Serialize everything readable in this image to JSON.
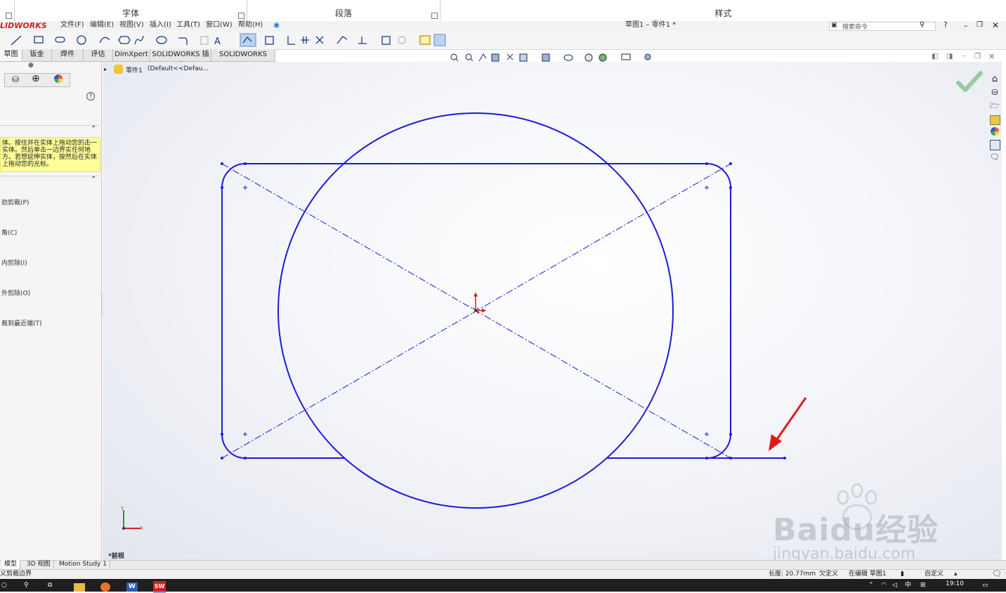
{
  "word_ribbon": {
    "groups": [
      {
        "label": "字体"
      },
      {
        "label": "段落"
      },
      {
        "label": "样式"
      }
    ]
  },
  "menubar": {
    "logo": "LIDWORKS",
    "items": [
      "文件(F)",
      "编辑(E)",
      "视图(V)",
      "插入(I)",
      "工具(T)",
      "窗口(W)",
      "帮助(H)"
    ],
    "doc_title": "草图1 – 零件1 *",
    "search_placeholder": "搜索命令",
    "help_label": "?"
  },
  "command_tabs": [
    "草图",
    "钣金",
    "焊件",
    "评估",
    "DimXpert",
    "SOLIDWORKS 插件",
    "SOLIDWORKS MBD"
  ],
  "feature_tree": {
    "root_label": "零件1",
    "config": "(Default<<Defau..."
  },
  "property_manager": {
    "help_icon": "?",
    "message": "体。按住并在实体上拖动您的击一实体。然后单击一边界实任何地方。若想延伸实体，按然后在实体上拖动您的光标。",
    "options": [
      "劲剪裁(P)",
      "角(C)",
      "内剪除(I)",
      "外剪除(O)",
      "裁到最近端(T)"
    ]
  },
  "viewport": {
    "view_label": "*前视",
    "axis_y": "Y",
    "axis_x": "X"
  },
  "bottom_tabs": [
    "模型",
    "3D 视图",
    "Motion Study 1"
  ],
  "status_bar": {
    "left": "义剪裁边界",
    "length": "长度: 20.77mm",
    "defined": "欠定义",
    "editing": "在编辑 草图1",
    "custom": "自定义"
  },
  "watermark": {
    "brand": "Baidu经验",
    "url": "jingyan.baidu.com"
  },
  "taskbar": {
    "time": "19:10",
    "ime": "中"
  },
  "colors": {
    "sketch_blue": "#1a1adc",
    "arrow_red": "#e0191b",
    "highlight_yellow": "#ffff99",
    "accept_green": "#7dc383"
  }
}
